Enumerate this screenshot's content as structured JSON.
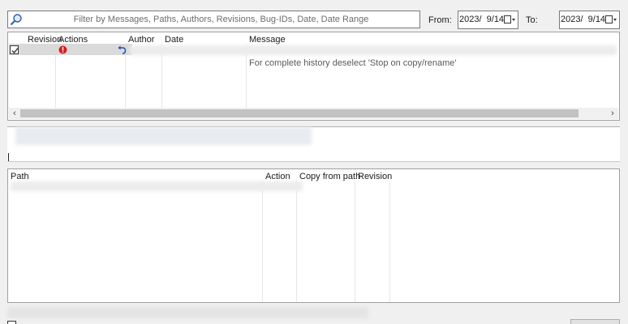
{
  "filter": {
    "placeholder": "Filter by Messages, Paths, Authors, Revisions, Bug-IDs, Date, Date Range",
    "value": ""
  },
  "date_range": {
    "from_label": "From:",
    "from_value": "2023/  9/14",
    "to_label": "To:",
    "to_value": "2023/  9/14"
  },
  "log_list": {
    "columns": [
      "Revision",
      "Actions",
      "Author",
      "Date",
      "Message"
    ],
    "selected_row": {
      "checked": true,
      "action_icons": [
        "error-icon",
        "revert-icon"
      ]
    },
    "info_message": "For complete history deselect 'Stop on copy/rename'"
  },
  "changed_paths": {
    "columns": [
      "Path",
      "Action",
      "Copy from path",
      "Revision"
    ]
  },
  "icons": {
    "search": "search-icon",
    "calendar_dropdown": "calendar-dropdown-icon",
    "scroll_left": "chevron-left-icon",
    "scroll_right": "chevron-right-icon"
  },
  "colors": {
    "error_red": "#d32020",
    "revert_blue": "#1f4fb4"
  }
}
